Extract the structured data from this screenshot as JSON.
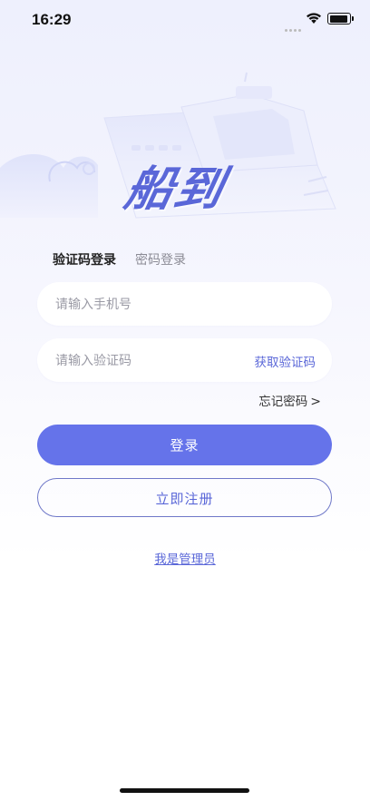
{
  "status_bar": {
    "time": "16:29"
  },
  "brand": {
    "logo_text": "船到"
  },
  "tabs": [
    {
      "label": "验证码登录",
      "active": true
    },
    {
      "label": "密码登录",
      "active": false
    }
  ],
  "phone_field": {
    "placeholder": "请输入手机号",
    "value": ""
  },
  "code_field": {
    "placeholder": "请输入验证码",
    "value": "",
    "get_code_label": "获取验证码"
  },
  "forgot_password": {
    "label": "忘记密码",
    "chevron": ">"
  },
  "buttons": {
    "login": "登录",
    "register": "立即注册"
  },
  "admin_link": "我是管理员",
  "colors": {
    "accent": "#6573ea",
    "link": "#5a67d8",
    "outline": "#6f78c8"
  },
  "icons": [
    "wifi-icon",
    "battery-icon",
    "chevron-right-icon"
  ]
}
